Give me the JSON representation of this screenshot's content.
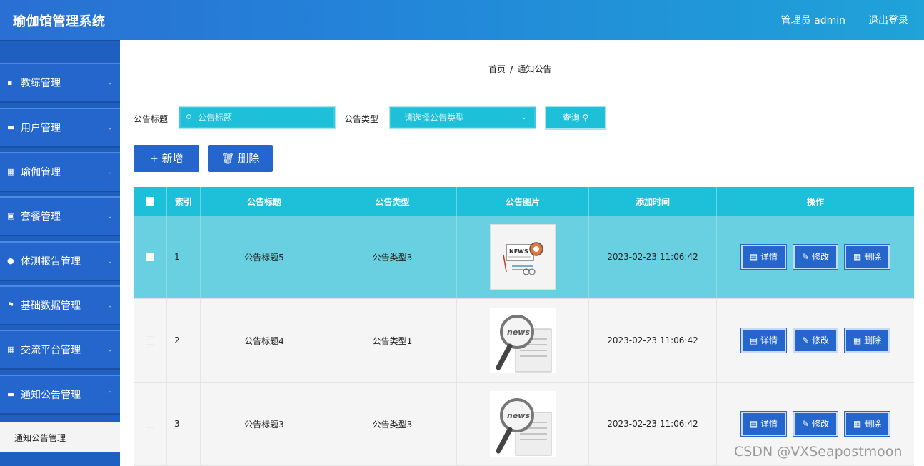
{
  "header": {
    "title": "瑜伽馆管理系统",
    "user": "管理员 admin",
    "logout": "退出登录"
  },
  "sidebar": {
    "items": [
      {
        "label": "教练管理",
        "icon": "briefcase-icon"
      },
      {
        "label": "用户管理",
        "icon": "monitor-icon"
      },
      {
        "label": "瑜伽管理",
        "icon": "grid-icon"
      },
      {
        "label": "套餐管理",
        "icon": "comment-icon"
      },
      {
        "label": "体测报告管理",
        "icon": "person-icon"
      },
      {
        "label": "基础数据管理",
        "icon": "flag-icon"
      },
      {
        "label": "交流平台管理",
        "icon": "grid-icon"
      },
      {
        "label": "通知公告管理",
        "icon": "monitor-icon"
      }
    ],
    "sub_item": "通知公告管理"
  },
  "breadcrumb": {
    "home": "首页",
    "sep": "/",
    "current": "通知公告"
  },
  "search": {
    "title_label": "公告标题",
    "title_placeholder": "公告标题",
    "type_label": "公告类型",
    "type_placeholder": "请选择公告类型",
    "query": "查询"
  },
  "toolbar": {
    "add": "+ 新增",
    "delete": "删除"
  },
  "table": {
    "headers": [
      "索引",
      "公告标题",
      "公告类型",
      "公告图片",
      "添加时间",
      "操作"
    ],
    "rows": [
      {
        "index": "1",
        "title": "公告标题5",
        "type": "公告类型3",
        "image": "news-sign-image",
        "time": "2023-02-23 11:06:42"
      },
      {
        "index": "2",
        "title": "公告标题4",
        "type": "公告类型1",
        "image": "news-magnifier-image",
        "time": "2023-02-23 11:06:42"
      },
      {
        "index": "3",
        "title": "公告标题3",
        "type": "公告类型3",
        "image": "news-magnifier-image",
        "time": "2023-02-23 11:06:42"
      }
    ],
    "actions": {
      "detail": "详情",
      "edit": "修改",
      "remove": "删除"
    }
  },
  "watermark": "CSDN @VXSeapostmoon",
  "colors": {
    "header_start": "#2a6fd4",
    "header_end": "#1fa3d8",
    "sidebar": "#2466cc",
    "accent": "#1ebfd8",
    "selected_row": "#68d0e0"
  }
}
